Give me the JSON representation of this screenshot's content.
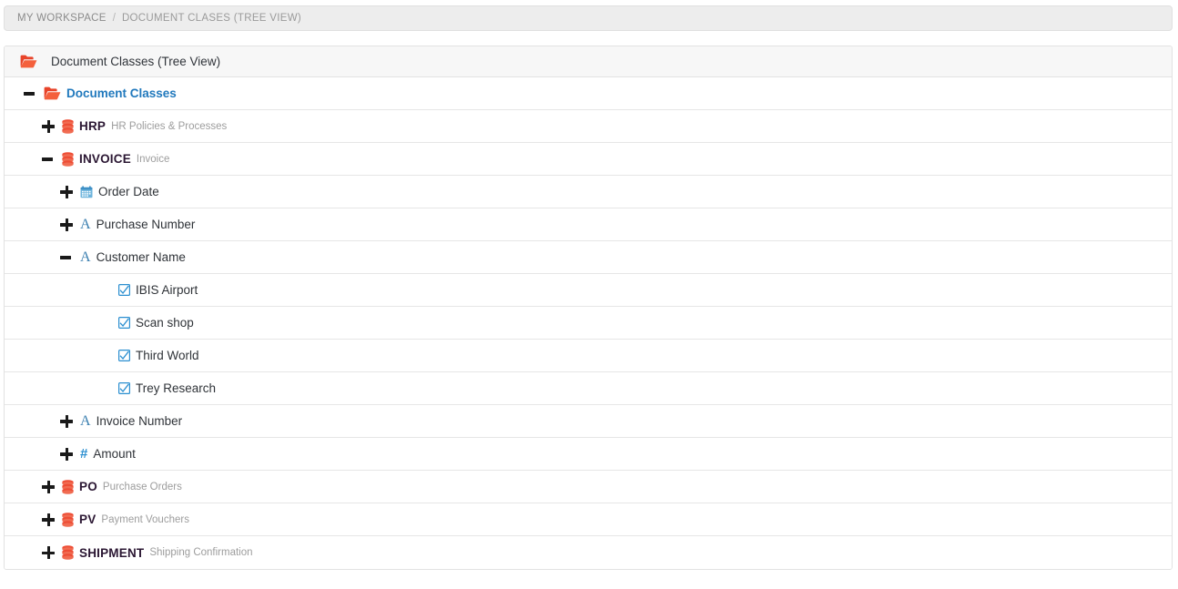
{
  "breadcrumb": {
    "root_label": "MY WORKSPACE",
    "separator": "/",
    "current_label": "DOCUMENT CLASES (TREE VIEW)"
  },
  "panel": {
    "header_label": "Document Classes (Tree View)",
    "header_icon": "folder-open-icon"
  },
  "colors": {
    "folder": "#ec5b3a",
    "database": "#ee4d35",
    "link": "#2179bd",
    "field_icon": "#3b8dc4",
    "checkbox": "#2b8fd0",
    "code_text": "#2b1733",
    "desc_text": "#9d9d9d",
    "row_border": "#e6e6e6",
    "panel_head_bg": "#f7f7f7",
    "breadcrumb_bg": "#ededed"
  },
  "tree": [
    {
      "id": "document-classes",
      "level": 0,
      "toggle": "minus",
      "icon": "folder-open-icon",
      "label": "Document Classes",
      "label_style": "link",
      "desc": ""
    },
    {
      "id": "hrp",
      "level": 1,
      "toggle": "plus",
      "icon": "database-icon",
      "label": "HRP",
      "label_style": "code",
      "desc": "HR Policies & Processes"
    },
    {
      "id": "invoice",
      "level": 1,
      "toggle": "minus",
      "icon": "database-icon",
      "label": "INVOICE",
      "label_style": "code",
      "desc": "Invoice"
    },
    {
      "id": "order-date",
      "level": 2,
      "toggle": "plus",
      "icon": "calendar-icon",
      "label": "Order Date",
      "label_style": "plain",
      "desc": ""
    },
    {
      "id": "purchase-number",
      "level": 2,
      "toggle": "plus",
      "icon": "text-field-icon",
      "label": "Purchase Number",
      "label_style": "plain",
      "desc": ""
    },
    {
      "id": "customer-name",
      "level": 2,
      "toggle": "minus",
      "icon": "text-field-icon",
      "label": "Customer Name",
      "label_style": "plain",
      "desc": ""
    },
    {
      "id": "ibis-airport",
      "level": 3,
      "toggle": "none",
      "icon": "checkbox-checked-icon",
      "label": "IBIS Airport",
      "label_style": "plain",
      "desc": ""
    },
    {
      "id": "scan-shop",
      "level": 3,
      "toggle": "none",
      "icon": "checkbox-checked-icon",
      "label": "Scan shop",
      "label_style": "plain",
      "desc": ""
    },
    {
      "id": "third-world",
      "level": 3,
      "toggle": "none",
      "icon": "checkbox-checked-icon",
      "label": "Third World",
      "label_style": "plain",
      "desc": ""
    },
    {
      "id": "trey-research",
      "level": 3,
      "toggle": "none",
      "icon": "checkbox-checked-icon",
      "label": "Trey Research",
      "label_style": "plain",
      "desc": ""
    },
    {
      "id": "invoice-number",
      "level": 2,
      "toggle": "plus",
      "icon": "text-field-icon",
      "label": "Invoice Number",
      "label_style": "plain",
      "desc": ""
    },
    {
      "id": "amount",
      "level": 2,
      "toggle": "plus",
      "icon": "number-field-icon",
      "label": "Amount",
      "label_style": "plain",
      "desc": ""
    },
    {
      "id": "po",
      "level": 1,
      "toggle": "plus",
      "icon": "database-icon",
      "label": "PO",
      "label_style": "code",
      "desc": "Purchase Orders"
    },
    {
      "id": "pv",
      "level": 1,
      "toggle": "plus",
      "icon": "database-icon",
      "label": "PV",
      "label_style": "code",
      "desc": "Payment Vouchers"
    },
    {
      "id": "shipment",
      "level": 1,
      "toggle": "plus",
      "icon": "database-icon",
      "label": "SHIPMENT",
      "label_style": "code",
      "desc": "Shipping Confirmation"
    }
  ]
}
